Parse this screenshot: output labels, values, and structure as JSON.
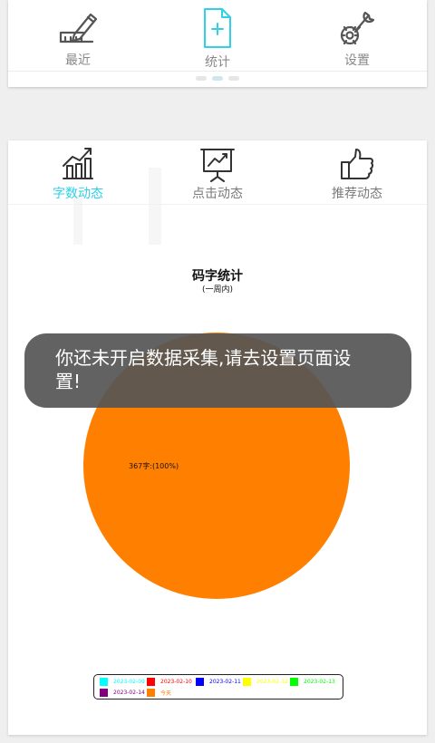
{
  "top_nav": {
    "tabs": [
      {
        "label": "最近",
        "icon": "edit-ruler-icon",
        "color": "#555555"
      },
      {
        "label": "统计",
        "icon": "document-add-icon",
        "color": "#2fd0e8"
      },
      {
        "label": "设置",
        "icon": "wrench-gear-icon",
        "color": "#555555"
      }
    ],
    "active_index": 1,
    "page_count": 3
  },
  "sub_nav": {
    "tabs": [
      {
        "label": "字数动态",
        "icon": "trend-chart-icon"
      },
      {
        "label": "点击动态",
        "icon": "presentation-board-icon"
      },
      {
        "label": "推荐动态",
        "icon": "thumbs-up-icon"
      }
    ],
    "active_index": 0,
    "active_color": "#2fd0e8"
  },
  "chart_data": {
    "type": "pie",
    "title": "码字统计",
    "subtitle": "(一周内)",
    "slices": [
      {
        "name": "今天",
        "value": 367,
        "percent": 100,
        "color": "#ff8000",
        "label": "367字:(100%)"
      }
    ],
    "legend_placement": "bottom",
    "legend": [
      {
        "name": "2023-02-09",
        "color": "#00ffff"
      },
      {
        "name": "2023-02-10",
        "color": "#ff0000"
      },
      {
        "name": "2023-02-11",
        "color": "#0000ff"
      },
      {
        "name": "2023-02-12",
        "color": "#ffff00"
      },
      {
        "name": "2023-02-13",
        "color": "#00ff00"
      },
      {
        "name": "2023-02-14",
        "color": "#800080"
      },
      {
        "name": "今天",
        "color": "#ff8000"
      }
    ]
  },
  "toast": {
    "line1": "你还未开启数据采集,请去设置页面设",
    "line2": "置!"
  }
}
